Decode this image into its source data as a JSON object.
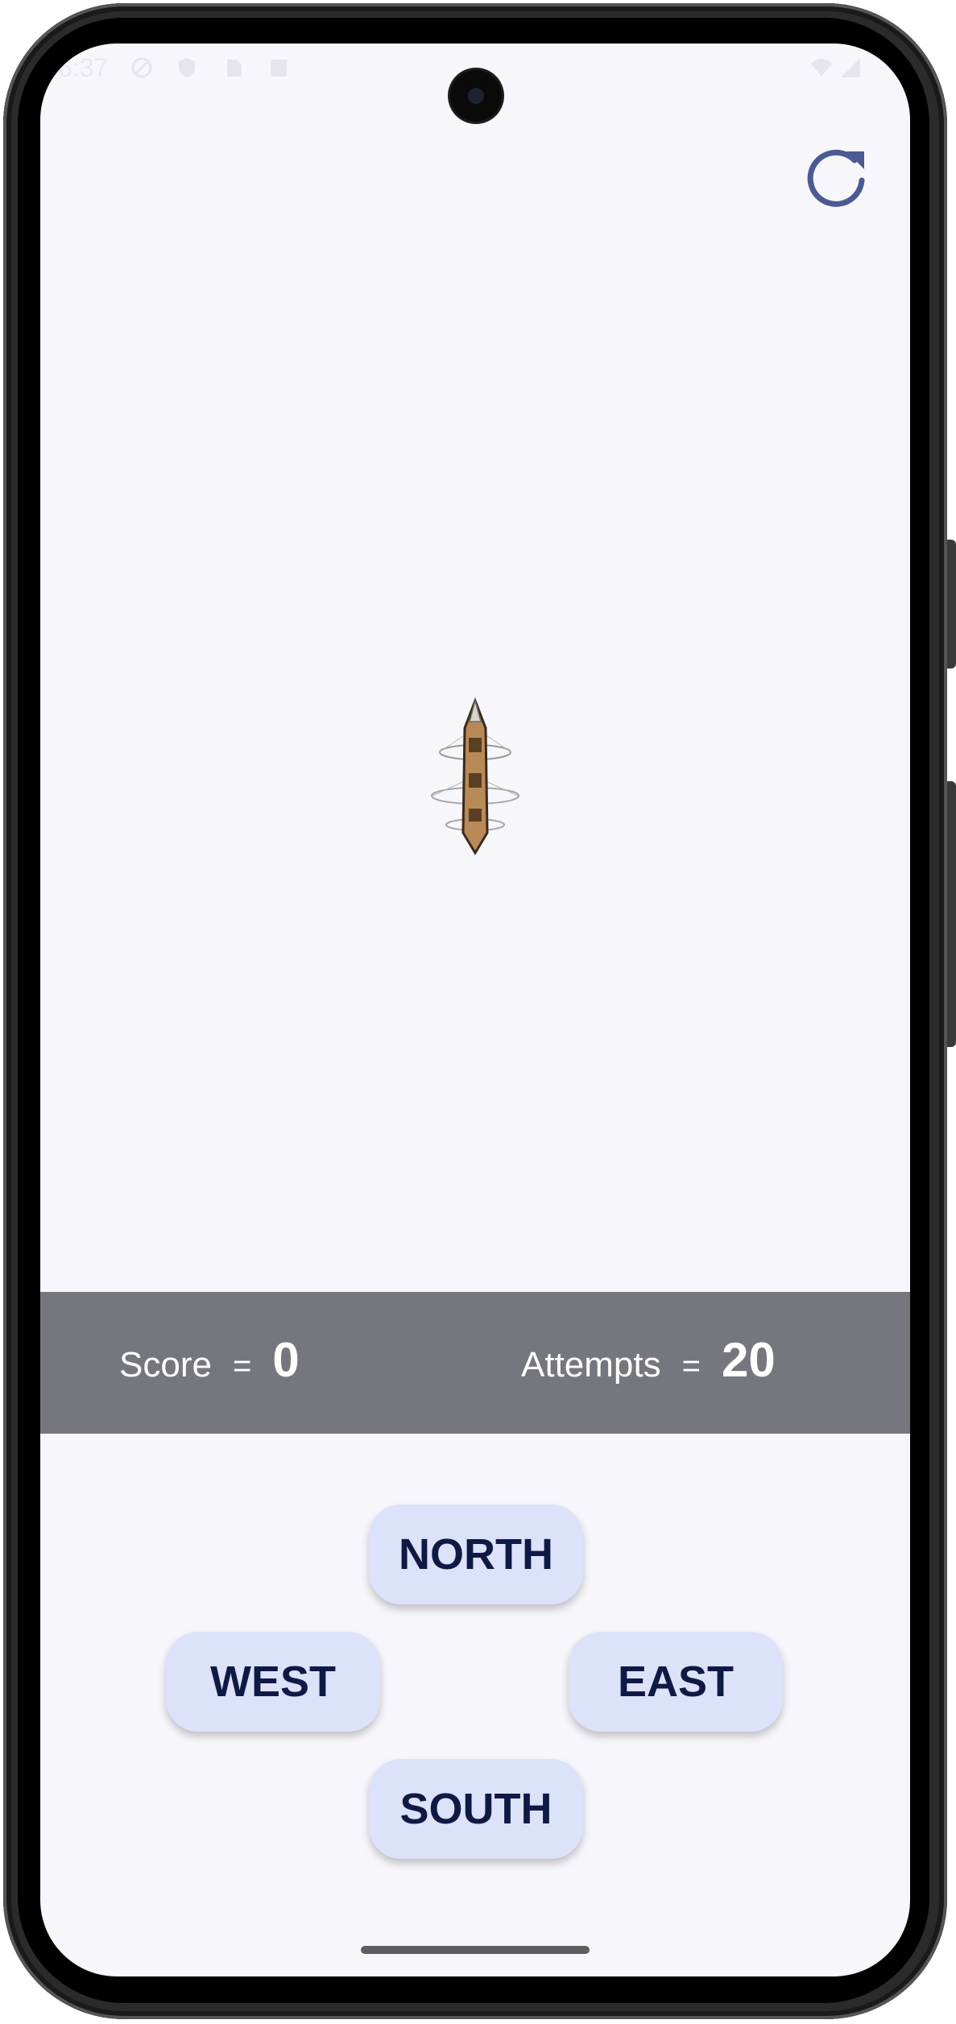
{
  "status_bar": {
    "time": "6:37",
    "icons": [
      "do-not-disturb-icon",
      "shield-icon",
      "sim-card-icon",
      "download-icon",
      "wifi-icon",
      "signal-icon"
    ]
  },
  "toolbar": {
    "refresh_icon": "refresh-icon",
    "accent_color": "#4a5a92"
  },
  "game": {
    "sprite": "airship-sprite"
  },
  "score_panel": {
    "score_label": "Score",
    "score_equals": "=",
    "score_value": "0",
    "attempts_label": "Attempts",
    "attempts_equals": "=",
    "attempts_value": "20",
    "background": "#76767f"
  },
  "controls": {
    "north_label": "NORTH",
    "west_label": "WEST",
    "east_label": "EAST",
    "south_label": "SOUTH",
    "button_color": "#dde2fb",
    "text_color": "#0f1a44"
  }
}
